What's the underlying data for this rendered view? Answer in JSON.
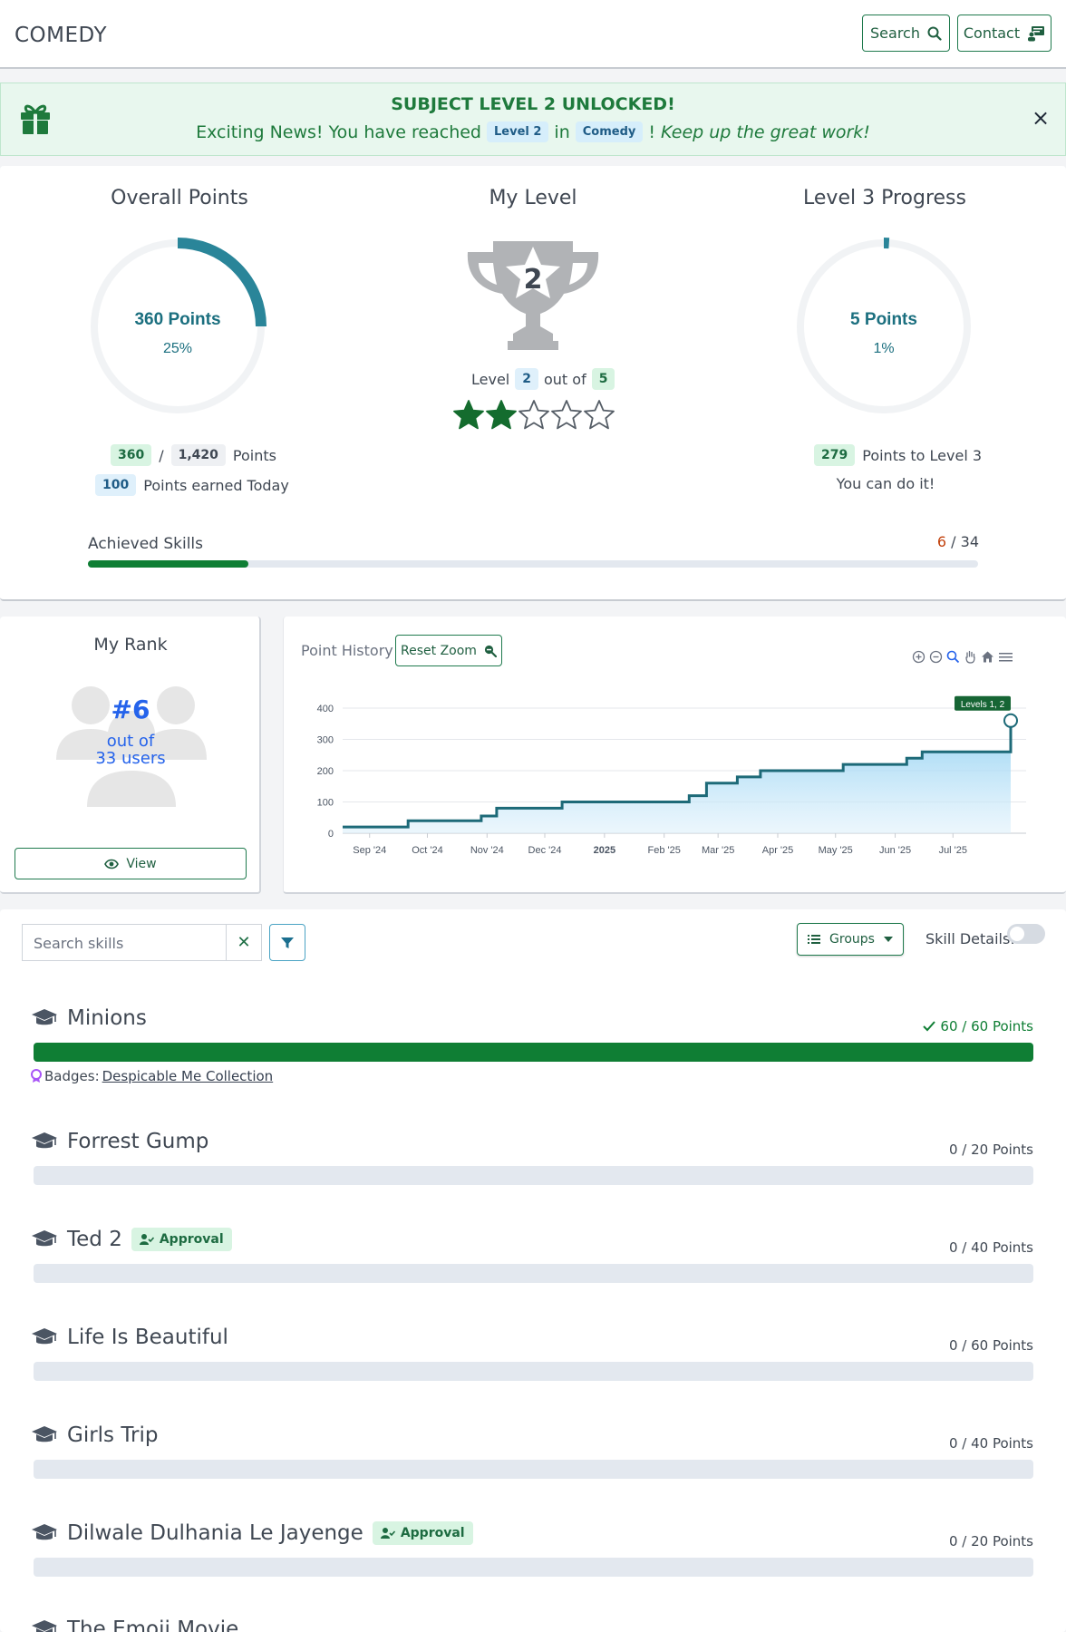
{
  "header": {
    "brand": "COMEDY",
    "search_label": "Search",
    "contact_label": "Contact"
  },
  "alert": {
    "title": "SUBJECT LEVEL 2 UNLOCKED!",
    "text_before": "Exciting News! You have reached",
    "level_chip": "Level 2",
    "text_in": "in",
    "subject_chip": "Comedy",
    "text_after": "!",
    "text_italic": "Keep up the great work!",
    "close_glyph": "×"
  },
  "overall": {
    "title": "Overall Points",
    "points_label": "360 Points",
    "percent_label": "25%",
    "progress_fraction": 0.25,
    "earned": "360",
    "slash": "/",
    "total": "1,420",
    "points_word": "Points",
    "today": "100",
    "today_label": "Points earned Today"
  },
  "level": {
    "title": "My Level",
    "current": "2",
    "level_word": "Level",
    "out_of": "out of",
    "max": "5",
    "stars_filled": 2,
    "stars_total": 5
  },
  "next_level": {
    "title": "Level 3 Progress",
    "points_label": "5 Points",
    "percent_label": "1%",
    "progress_fraction": 0.01,
    "remaining": "279",
    "remaining_label": "Points to Level 3",
    "encouragement": "You can do it!"
  },
  "achieved": {
    "label": "Achieved Skills",
    "done": "6",
    "sep": "/",
    "total": "34",
    "fraction": 0.18
  },
  "rank": {
    "title": "My Rank",
    "position": "#6",
    "out_of": "out of",
    "users_count": "33",
    "users_word": "users",
    "view_label": "View"
  },
  "point_history": {
    "title": "Point History",
    "reset_zoom_label": "Reset Zoom"
  },
  "chart_data": {
    "type": "area",
    "title": "",
    "xlabel": "",
    "ylabel": "",
    "ylim": [
      0,
      400
    ],
    "yticks": [
      "0",
      "100",
      "200",
      "300",
      "400"
    ],
    "xticks": [
      "Sep '24",
      "Oct '24",
      "Nov '24",
      "Dec '24",
      "2025",
      "Feb '25",
      "Mar '25",
      "Apr '25",
      "May '25",
      "Jun '25",
      "Jul '25"
    ],
    "x": [
      "2024-08-18",
      "2024-09-21",
      "2024-10-21",
      "2024-10-29",
      "2024-11-06",
      "2024-12-10",
      "2025-02-06",
      "2025-02-14",
      "2025-02-23",
      "2025-03-11",
      "2025-03-23",
      "2025-05-05",
      "2025-06-07",
      "2025-06-15",
      "2025-07-27",
      "2025-07-31"
    ],
    "series": [
      {
        "values": [
          20,
          40,
          40,
          55,
          80,
          100,
          100,
          120,
          160,
          180,
          200,
          220,
          240,
          260,
          260,
          360
        ]
      }
    ],
    "annotation": "Levels 1, 2",
    "grid": true,
    "legend": "none"
  },
  "skills_toolbar": {
    "search_placeholder": "Search skills",
    "clear_glyph": "✕",
    "groups_label": "Groups",
    "skill_details_label": "Skill Details:"
  },
  "skills": [
    {
      "name": "Minions",
      "points": "60 / 60 Points",
      "fraction": 1.0,
      "approval": "",
      "badges_label": "Badges:",
      "badge_name": "Despicable Me Collection"
    },
    {
      "name": "Forrest Gump",
      "points": "0 / 20 Points",
      "fraction": 0,
      "approval": ""
    },
    {
      "name": "Ted 2",
      "points": "0 / 40 Points",
      "fraction": 0,
      "approval": "Approval"
    },
    {
      "name": "Life Is Beautiful",
      "points": "0 / 60 Points",
      "fraction": 0,
      "approval": ""
    },
    {
      "name": "Girls Trip",
      "points": "0 / 40 Points",
      "fraction": 0,
      "approval": ""
    },
    {
      "name": "Dilwale Dulhania Le Jayenge",
      "points": "0 / 20 Points",
      "fraction": 0,
      "approval": "Approval"
    },
    {
      "name": "The Emoji Movie",
      "points": "",
      "fraction": 0,
      "approval": ""
    }
  ]
}
